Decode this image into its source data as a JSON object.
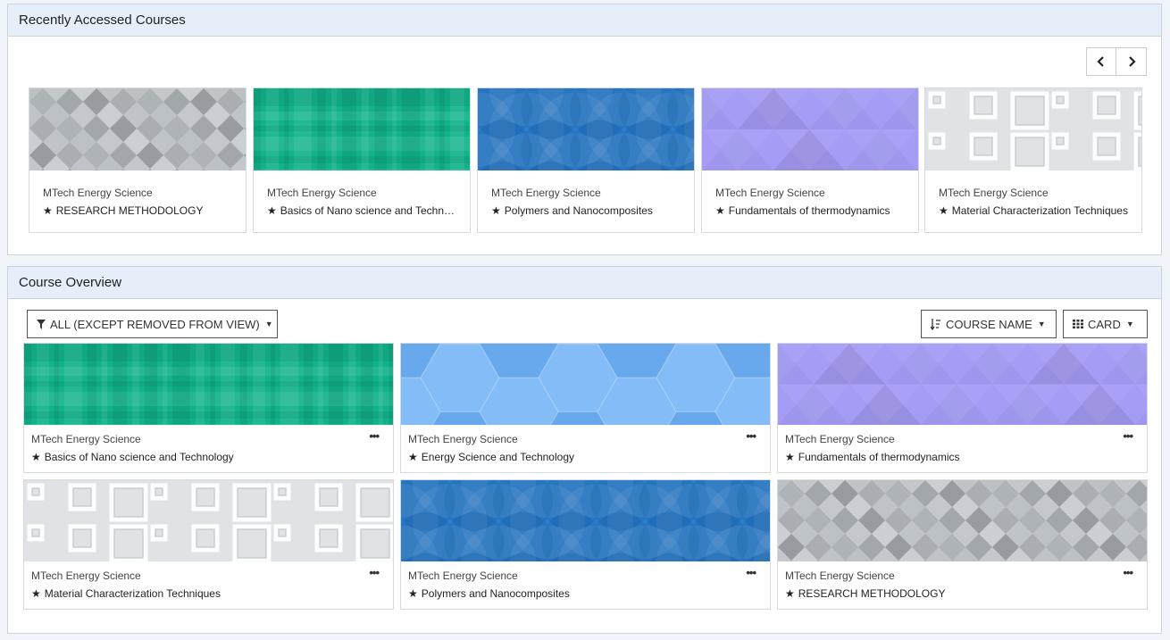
{
  "recent": {
    "title": "Recently Accessed Courses",
    "courses": [
      {
        "category": "MTech Energy Science",
        "name": "RESEARCH METHODOLOGY",
        "pattern": "gray-diamonds"
      },
      {
        "category": "MTech Energy Science",
        "name": "Basics of Nano science and Technology",
        "pattern": "green-plaid"
      },
      {
        "category": "MTech Energy Science",
        "name": "Polymers and Nanocomposites",
        "pattern": "blue-circles"
      },
      {
        "category": "MTech Energy Science",
        "name": "Fundamentals of thermodynamics",
        "pattern": "purple-triangles"
      },
      {
        "category": "MTech Energy Science",
        "name": "Material Characterization Techniques",
        "pattern": "light-squares"
      }
    ]
  },
  "overview": {
    "title": "Course Overview",
    "filter_label": "ALL (EXCEPT REMOVED FROM VIEW)",
    "sort_label": "COURSE NAME",
    "view_label": "CARD",
    "menu_glyph": "•••",
    "courses": [
      {
        "category": "MTech Energy Science",
        "name": "Basics of Nano science and Technology",
        "pattern": "green-plaid"
      },
      {
        "category": "MTech Energy Science",
        "name": "Energy Science and Technology",
        "pattern": "light-blue-hexagons"
      },
      {
        "category": "MTech Energy Science",
        "name": "Fundamentals of thermodynamics",
        "pattern": "purple-triangles"
      },
      {
        "category": "MTech Energy Science",
        "name": "Material Characterization Techniques",
        "pattern": "light-squares"
      },
      {
        "category": "MTech Energy Science",
        "name": "Polymers and Nanocomposites",
        "pattern": "blue-circles"
      },
      {
        "category": "MTech Energy Science",
        "name": "RESEARCH METHODOLOGY",
        "pattern": "gray-diamonds"
      }
    ]
  },
  "colors": {
    "header_bg": "#e6eefa",
    "green": "#12b38a",
    "blue": "#1a73c8",
    "light_blue": "#74b3f7",
    "purple": "#a49cf5",
    "gray": "#b7bcc1",
    "light_gray": "#dfe3e6"
  }
}
